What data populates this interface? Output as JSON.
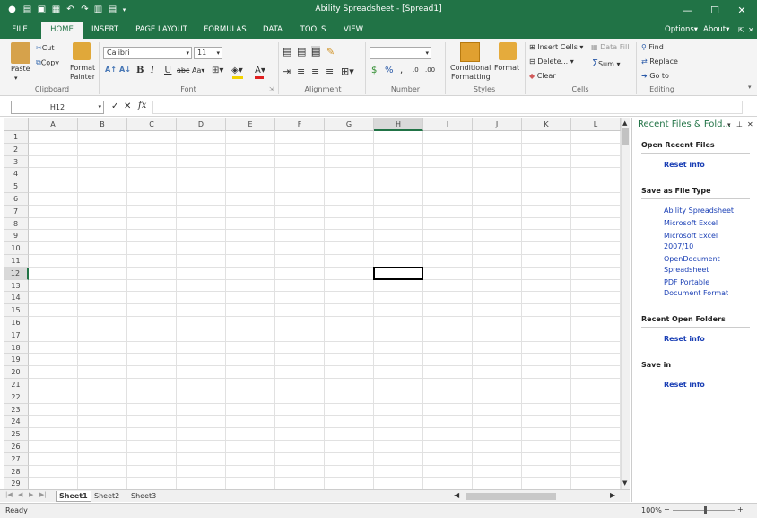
{
  "window": {
    "title": "Ability Spreadsheet - [Spread1]"
  },
  "tabs": [
    "FILE",
    "HOME",
    "INSERT",
    "PAGE LAYOUT",
    "FORMULAS",
    "DATA",
    "TOOLS",
    "VIEW"
  ],
  "tabs_right": {
    "options": "Options",
    "about": "About"
  },
  "ribbon": {
    "clipboard": {
      "paste": "Paste",
      "cut": "Cut",
      "copy": "Copy",
      "format_painter_1": "Format",
      "format_painter_2": "Painter",
      "label": "Clipboard"
    },
    "font": {
      "family": "Calibri",
      "size": "11",
      "label": "Font"
    },
    "alignment": {
      "label": "Alignment"
    },
    "number": {
      "format": "",
      "label": "Number"
    },
    "styles": {
      "cond_1": "Conditional",
      "cond_2": "Formatting",
      "format": "Format",
      "label": "Styles"
    },
    "cells": {
      "insert": "Insert Cells",
      "delete": "Delete...",
      "clear": "Clear",
      "label": "Cells"
    },
    "editing": {
      "data_fill": "Data Fill",
      "sum": "Sum",
      "find": "Find",
      "replace": "Replace",
      "goto": "Go to",
      "label": "Editing"
    }
  },
  "formula_bar": {
    "name_box": "H12",
    "fx": "fx",
    "content": ""
  },
  "grid": {
    "columns": [
      "A",
      "B",
      "C",
      "D",
      "E",
      "F",
      "G",
      "H",
      "I",
      "J",
      "K",
      "L"
    ],
    "rows": [
      "1",
      "2",
      "3",
      "4",
      "5",
      "6",
      "7",
      "8",
      "9",
      "10",
      "11",
      "12",
      "13",
      "14",
      "15",
      "16",
      "17",
      "18",
      "19",
      "20",
      "21",
      "22",
      "23",
      "24",
      "25",
      "26",
      "27",
      "28",
      "29"
    ],
    "selected_column": "H",
    "selected_row": "12"
  },
  "sheets": [
    "Sheet1",
    "Sheet2",
    "Sheet3"
  ],
  "status": {
    "ready": "Ready",
    "zoom": "100%"
  },
  "pane": {
    "title": "Recent Files & Fold...",
    "open_recent": {
      "heading": "Open Recent Files",
      "reset": "Reset info"
    },
    "save_type": {
      "heading": "Save as File Type",
      "items": [
        "Ability Spreadsheet",
        "Microsoft Excel",
        "Microsoft Excel 2007/10",
        "OpenDocument Spreadsheet",
        "PDF Portable Document Format"
      ]
    },
    "recent_folders": {
      "heading": "Recent Open Folders",
      "reset": "Reset info"
    },
    "save_in": {
      "heading": "Save in",
      "reset": "Reset info"
    }
  },
  "colors": {
    "accent": "#217346",
    "link": "#1a3fb5"
  }
}
